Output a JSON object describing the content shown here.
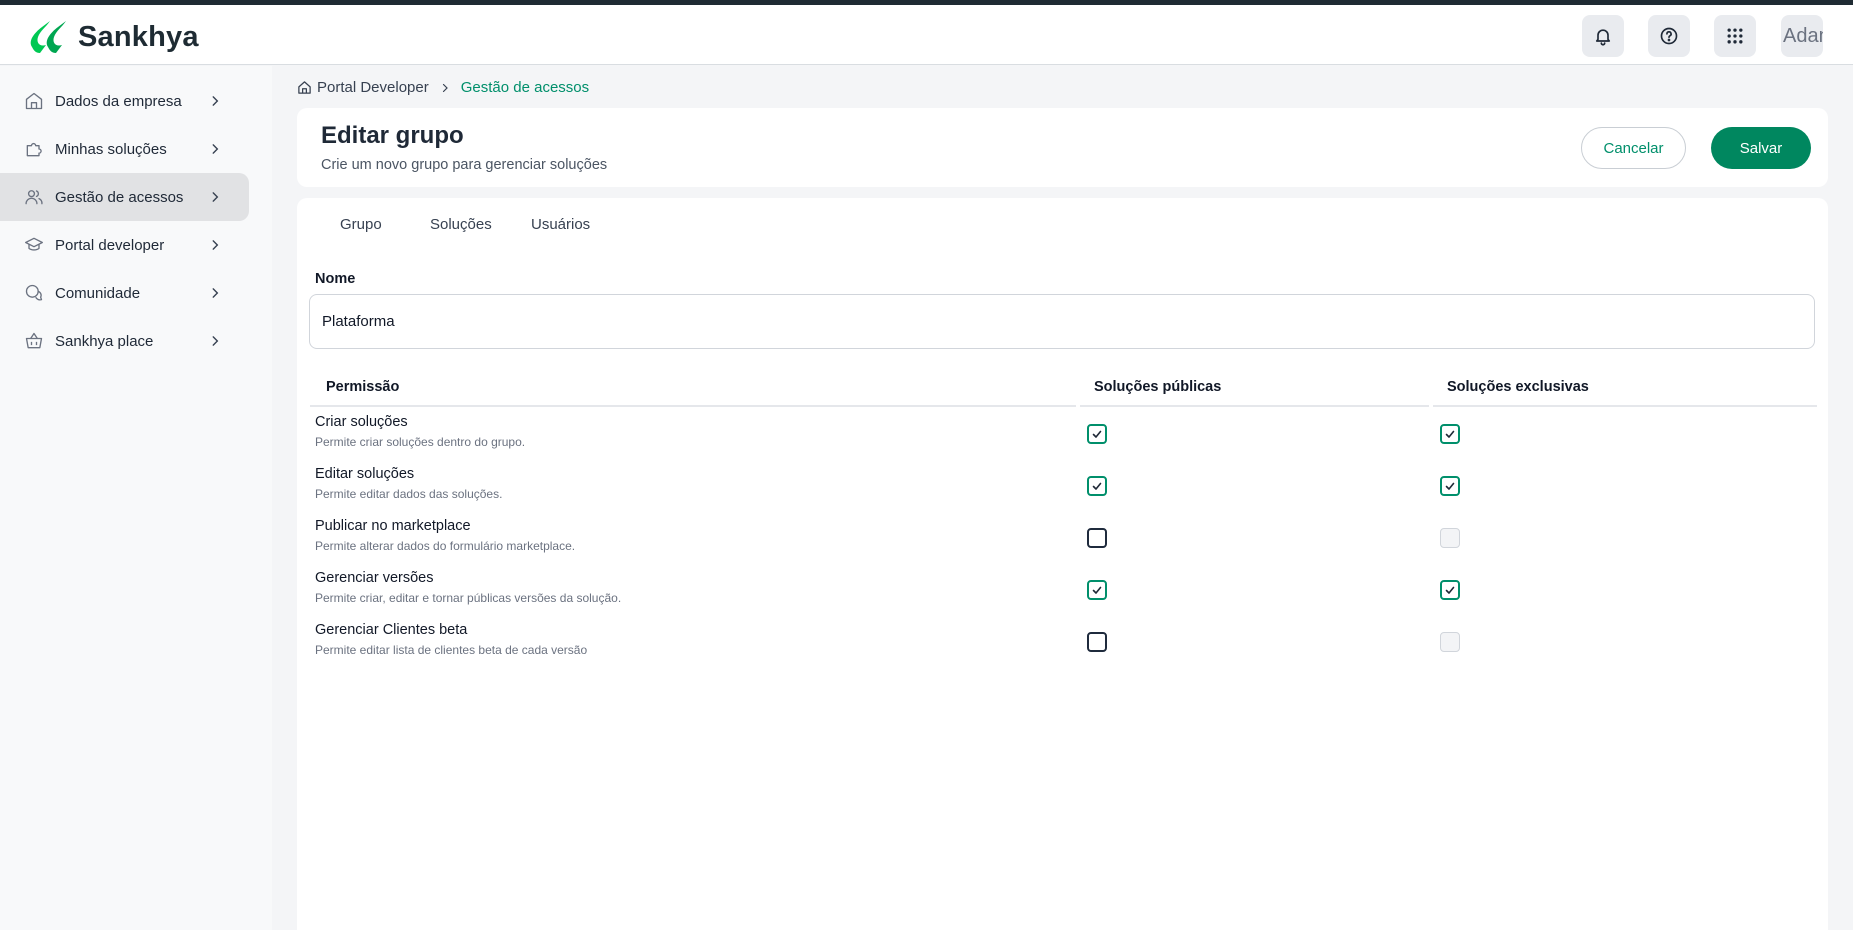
{
  "app": {
    "brand": "Sankhya",
    "avatar_alt": "Adam"
  },
  "topbar": {
    "icons": [
      "bell-icon",
      "help-icon",
      "apps-grid-icon"
    ]
  },
  "sidebar": {
    "items": [
      {
        "label": "Dados da empresa",
        "icon": "building-icon",
        "active": false
      },
      {
        "label": "Minhas soluções",
        "icon": "puzzle-icon",
        "active": false
      },
      {
        "label": "Gestão de acessos",
        "icon": "users-icon",
        "active": true
      },
      {
        "label": "Portal developer",
        "icon": "graduation-cap-icon",
        "active": false
      },
      {
        "label": "Comunidade",
        "icon": "chat-icon",
        "active": false
      },
      {
        "label": "Sankhya place",
        "icon": "basket-icon",
        "active": false
      }
    ]
  },
  "breadcrumb": {
    "home": "Portal Developer",
    "current": "Gestão de acessos"
  },
  "header": {
    "title": "Editar grupo",
    "subtitle": "Crie um novo grupo para gerenciar soluções",
    "cancel_label": "Cancelar",
    "save_label": "Salvar"
  },
  "tabs": [
    "Grupo",
    "Soluções",
    "Usuários"
  ],
  "form": {
    "name_label": "Nome",
    "name_value": "Plataforma"
  },
  "table": {
    "columns": [
      "Permissão",
      "Soluções públicas",
      "Soluções exclusivas"
    ],
    "rows": [
      {
        "title": "Criar soluções",
        "desc": "Permite criar soluções dentro do grupo.",
        "public": "checked",
        "exclusive": "checked"
      },
      {
        "title": "Editar soluções",
        "desc": "Permite editar dados das soluções.",
        "public": "checked",
        "exclusive": "checked"
      },
      {
        "title": "Publicar no marketplace",
        "desc": "Permite alterar dados do formulário marketplace.",
        "public": "unchecked",
        "exclusive": "disabled"
      },
      {
        "title": "Gerenciar versões",
        "desc": "Permite criar, editar e tornar públicas versões da solução.",
        "public": "checked",
        "exclusive": "checked"
      },
      {
        "title": "Gerenciar Clientes beta",
        "desc": "Permite editar lista de clientes beta de cada versão",
        "public": "unchecked",
        "exclusive": "disabled"
      }
    ]
  },
  "colors": {
    "accent": "#008f6b",
    "brand_green": "#00c853",
    "save_button": "#00875f"
  }
}
